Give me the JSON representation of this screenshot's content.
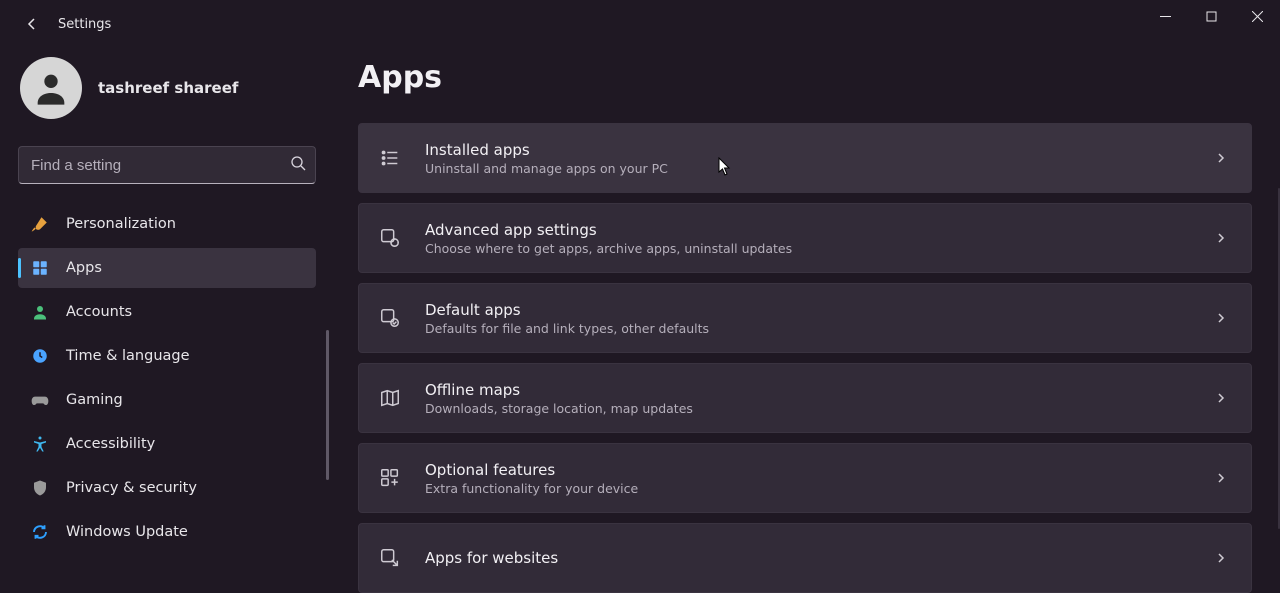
{
  "window": {
    "title": "Settings"
  },
  "user": {
    "name": "tashreef shareef"
  },
  "search": {
    "placeholder": "Find a setting"
  },
  "sidebar": {
    "items": [
      {
        "id": "personalization",
        "label": "Personalization",
        "icon": "paintbrush-icon",
        "color": "#e7a13e",
        "selected": false
      },
      {
        "id": "apps",
        "label": "Apps",
        "icon": "apps-grid-icon",
        "color": "#6bb3ff",
        "selected": true
      },
      {
        "id": "accounts",
        "label": "Accounts",
        "icon": "person-icon",
        "color": "#4bc07b",
        "selected": false
      },
      {
        "id": "time-language",
        "label": "Time & language",
        "icon": "globe-clock-icon",
        "color": "#4aa3ff",
        "selected": false
      },
      {
        "id": "gaming",
        "label": "Gaming",
        "icon": "gamepad-icon",
        "color": "#9a9a9a",
        "selected": false
      },
      {
        "id": "accessibility",
        "label": "Accessibility",
        "icon": "accessibility-icon",
        "color": "#3fb8f0",
        "selected": false
      },
      {
        "id": "privacy",
        "label": "Privacy & security",
        "icon": "shield-icon",
        "color": "#9a9a9a",
        "selected": false
      },
      {
        "id": "windows-update",
        "label": "Windows Update",
        "icon": "update-icon",
        "color": "#2ea0ff",
        "selected": false
      }
    ]
  },
  "main": {
    "title": "Apps",
    "cards": [
      {
        "id": "installed-apps",
        "title": "Installed apps",
        "sub": "Uninstall and manage apps on your PC",
        "icon": "list-icon",
        "hovered": true
      },
      {
        "id": "advanced-settings",
        "title": "Advanced app settings",
        "sub": "Choose where to get apps, archive apps, uninstall updates",
        "icon": "app-gear-icon",
        "hovered": false
      },
      {
        "id": "default-apps",
        "title": "Default apps",
        "sub": "Defaults for file and link types, other defaults",
        "icon": "app-check-icon",
        "hovered": false
      },
      {
        "id": "offline-maps",
        "title": "Offline maps",
        "sub": "Downloads, storage location, map updates",
        "icon": "map-icon",
        "hovered": false
      },
      {
        "id": "optional-features",
        "title": "Optional features",
        "sub": "Extra functionality for your device",
        "icon": "app-plus-icon",
        "hovered": false
      },
      {
        "id": "apps-for-websites",
        "title": "Apps for websites",
        "sub": "",
        "icon": "app-link-icon",
        "hovered": false
      }
    ]
  }
}
